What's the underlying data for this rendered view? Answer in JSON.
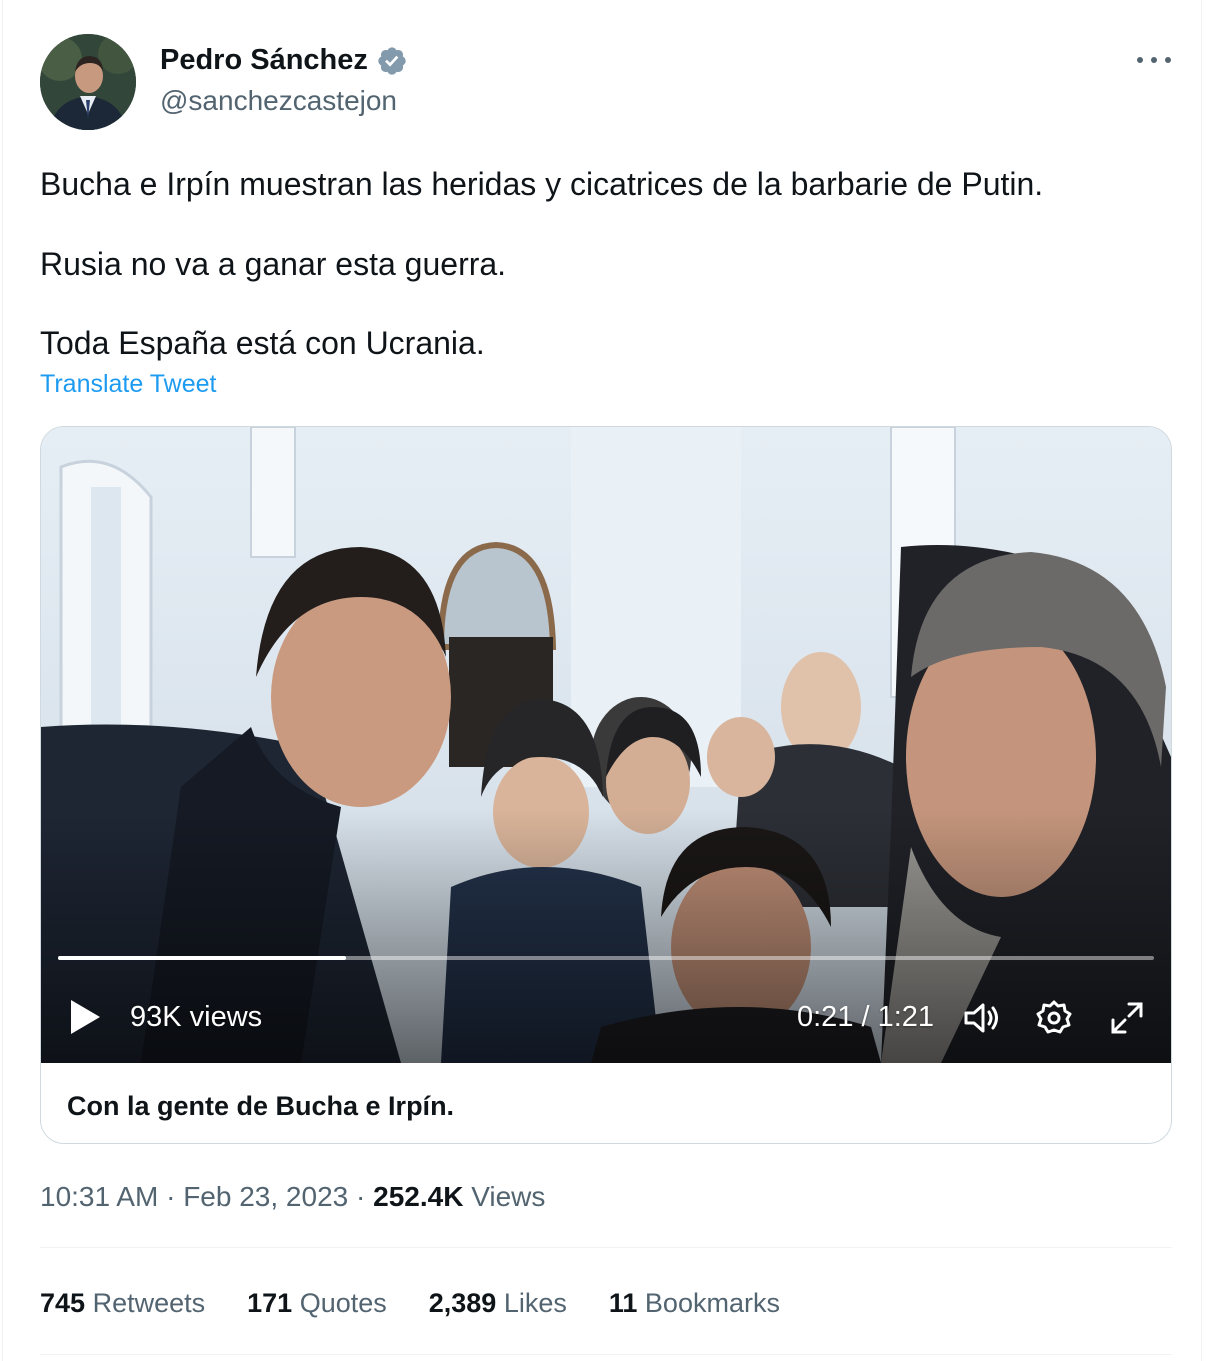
{
  "author": {
    "name": "Pedro Sánchez",
    "handle": "@sanchezcastejon",
    "verified": true
  },
  "tweet": {
    "line1": "Bucha e Irpín muestran las heridas y cicatrices de la barbarie de Putin.",
    "line2": "Rusia no va a ganar esta guerra.",
    "line3": "Toda España está con Ucrania.",
    "translate_label": "Translate Tweet"
  },
  "video": {
    "views": "93K views",
    "time": "0:21 / 1:21",
    "progress": 0.263,
    "caption": "Con la gente de Bucha e Irpín."
  },
  "meta": {
    "time": "10:31 AM",
    "sep1": " · ",
    "date": "Feb 23, 2023",
    "sep2": " · ",
    "views_count": "252.4K",
    "views_label": " Views"
  },
  "stats": [
    {
      "num": "745",
      "label": " Retweets"
    },
    {
      "num": "171",
      "label": " Quotes"
    },
    {
      "num": "2,389",
      "label": " Likes"
    },
    {
      "num": "11",
      "label": " Bookmarks"
    }
  ],
  "colors": {
    "accent": "#1d9bf0",
    "text": "#0f1419",
    "secondary": "#536471",
    "verified": "#829aab"
  }
}
